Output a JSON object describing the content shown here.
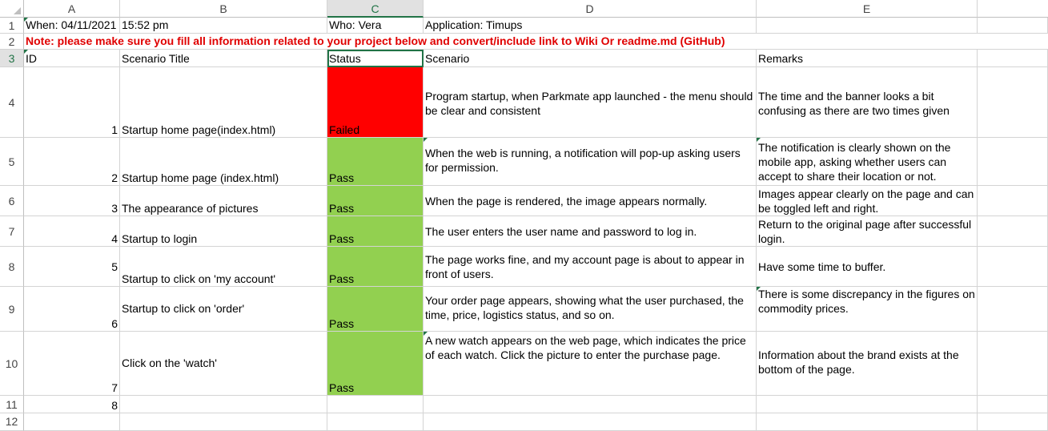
{
  "columns": [
    "A",
    "B",
    "C",
    "D",
    "E"
  ],
  "selected_column": "C",
  "rows": [
    "1",
    "2",
    "3",
    "4",
    "5",
    "6",
    "7",
    "8",
    "9",
    "10",
    "11",
    "12"
  ],
  "row1": {
    "a": "When: 04/11/2021",
    "b": "15:52 pm",
    "c": "Who: Vera",
    "d": "Application: Timups"
  },
  "row2": {
    "note": "Note: please make sure you fill all information related to your project below and convert/include link to Wiki Or readme.md (GitHub)"
  },
  "headers": {
    "id": "ID",
    "title": "Scenario Title",
    "status": "Status",
    "scenario": "Scenario",
    "remarks": "Remarks"
  },
  "scenarios": [
    {
      "id": "1",
      "title": "Startup home page(index.html)",
      "status": "Failed",
      "scenario": "Program startup, when Parkmate app launched - the menu should be clear and consistent",
      "remarks": "The time and the banner looks a bit confusing as there are two times given"
    },
    {
      "id": "2",
      "title": "Startup home page (index.html)",
      "status": "Pass",
      "scenario": "When the web is running, a notification will pop-up asking users for permission.",
      "remarks": "The notification is clearly shown on the mobile app, asking whether users can accept to share their location or not."
    },
    {
      "id": "3",
      "title": "The appearance of pictures",
      "status": "Pass",
      "scenario": "When the page is rendered, the image appears normally.",
      "remarks": "Images appear clearly on the page and can be toggled left and right."
    },
    {
      "id": "4",
      "title": "Startup to login",
      "status": "Pass",
      "scenario": "The user enters the user name and password to log in.",
      "remarks": "Return to the original page after successful login."
    },
    {
      "id": "5",
      "title": "Startup to click on 'my account'",
      "status": "Pass",
      "scenario": "The page works fine, and my account page is about to appear in front of users.",
      "remarks": "Have some time to buffer."
    },
    {
      "id": "6",
      "title": "Startup to click on 'order'",
      "status": "Pass",
      "scenario": "Your order page appears, showing what the user purchased, the time, price, logistics status, and so on.",
      "remarks": "There is some discrepancy in the figures on commodity prices."
    },
    {
      "id": "7",
      "title": "Click on the 'watch'",
      "status": "Pass",
      "scenario": "A new watch appears on the web page, which indicates the price of each watch. Click the picture to enter the purchase page.",
      "remarks": "Information about the brand exists at the bottom of the page."
    },
    {
      "id": "8",
      "title": "",
      "status": "",
      "scenario": "",
      "remarks": ""
    }
  ],
  "colors": {
    "failed": "#ff0000",
    "pass": "#92d050",
    "note": "#e00000",
    "selection": "#217346"
  }
}
